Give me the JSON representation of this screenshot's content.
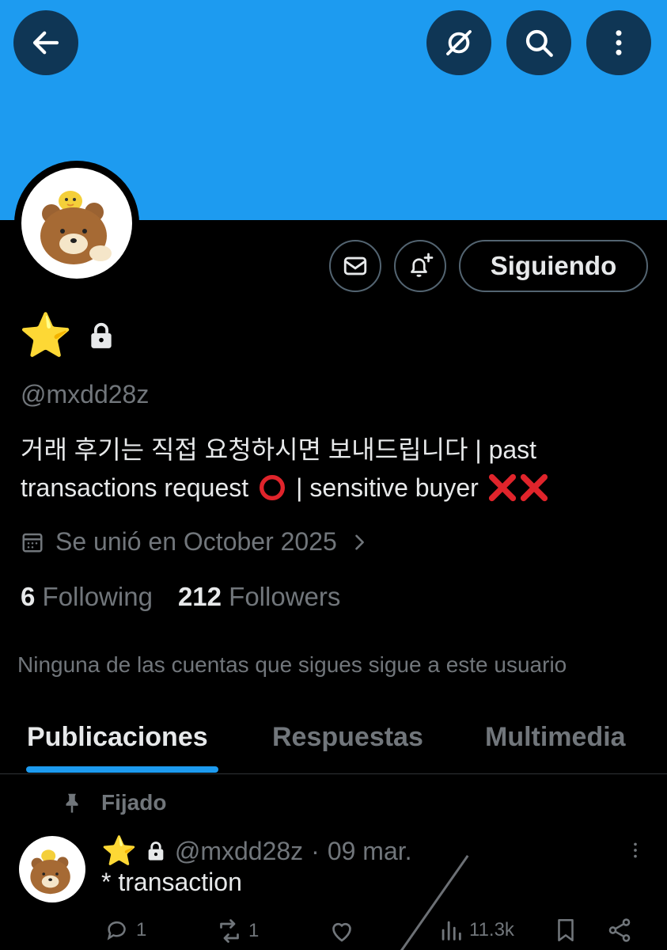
{
  "header": {
    "back_icon": "arrow-left-icon",
    "translate_icon": "grok-icon",
    "search_icon": "search-icon",
    "more_icon": "more-vertical-icon"
  },
  "profile": {
    "name_emoji": "⭐",
    "protected_icon": "lock-icon",
    "handle": "@mxdd28z",
    "bio_line1": "거래 후기는 직접 요청하시면 보내드립니다 | past",
    "bio_line2_a": "transactions request",
    "bio_line2_b": "| sensitive buyer",
    "joined": "Se unió en October 2025",
    "following_count": "6",
    "following_label": "Following",
    "followers_count": "212",
    "followers_label": "Followers",
    "mutual_text": "Ninguna de las cuentas que sigues sigue a este usuario"
  },
  "actions": {
    "message_icon": "mail-icon",
    "notify_icon": "bell-plus-icon",
    "follow_label": "Siguiendo"
  },
  "tabs": [
    {
      "label": "Publicaciones",
      "active": true
    },
    {
      "label": "Respuestas",
      "active": false
    },
    {
      "label": "Multimedia",
      "active": false
    }
  ],
  "pinned_label": "Fijado",
  "post": {
    "name_emoji": "⭐",
    "handle": "@mxdd28z",
    "separator": "·",
    "date": "09 mar.",
    "text": "* transaction",
    "replies": "1",
    "retweets": "1",
    "views": "11.3k"
  },
  "colors": {
    "banner": "#1d9bf0",
    "accent": "#1d9bf0",
    "background": "#000000",
    "muted_text": "#71767b"
  }
}
